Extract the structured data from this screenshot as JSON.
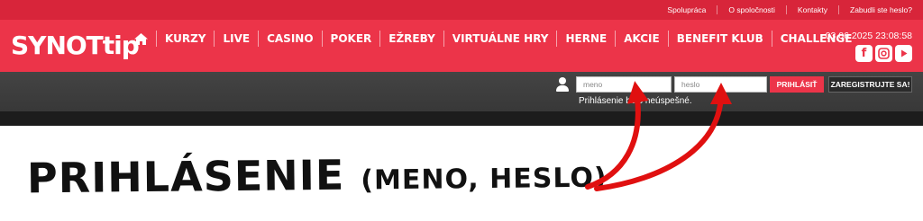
{
  "toplinks": [
    "Spolupráca",
    "O spoločnosti",
    "Kontakty",
    "Zabudli ste heslo?"
  ],
  "header": {
    "logo": "SYNOTtip",
    "nav": [
      "KURZY",
      "LIVE",
      "CASINO",
      "POKER",
      "EŽREBY",
      "VIRTUÁLNE HRY",
      "HERNE",
      "AKCIE",
      "BENEFIT KLUB",
      "CHALLENGE"
    ],
    "datetime": "03.06.2025 23:08:58",
    "socials": [
      "facebook-icon",
      "instagram-icon",
      "youtube-icon"
    ]
  },
  "login": {
    "username_placeholder": "meno",
    "password_placeholder": "heslo",
    "login_label": "PRIHLÁSIŤ",
    "register_label": "ZAREGISTRUJTE SA!",
    "error": "Prihlásenie bolo neúspešné."
  },
  "caption": {
    "main": "PRIHLÁSENIE",
    "sub": "(MENO, HESLO)"
  },
  "colors": {
    "brand_red": "#ec3449",
    "topbar_red": "#d8253a",
    "login_bar": "#3e3e3e",
    "arrow_red": "#e01010"
  }
}
